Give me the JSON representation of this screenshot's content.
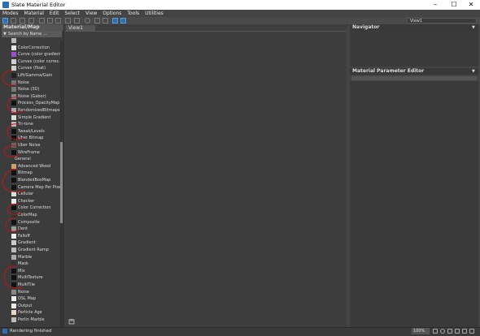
{
  "window": {
    "title": "Slate Material Editor",
    "controls": [
      "–",
      "☐",
      "✕"
    ]
  },
  "menu": [
    "Modes",
    "Material",
    "Edit",
    "Select",
    "View",
    "Options",
    "Tools",
    "Utilities"
  ],
  "toolbar": {
    "view_dropdown": "View1"
  },
  "material_browser": {
    "title": "Material/Map Browser",
    "search_placeholder": "Search by Name ...",
    "sections": [
      {
        "rows": [
          {
            "label": "",
            "swatch": "#bdbdbd"
          },
          {
            "label": "ColorCorrection",
            "swatch": "#e8e8e8"
          },
          {
            "label": "Curve (color gradient)",
            "swatch": "#9a4fc8"
          },
          {
            "label": "Curves (color correc...",
            "swatch": "#cfcfcf"
          },
          {
            "label": "Curves (float)",
            "swatch": "#cfcfcf"
          },
          {
            "label": "Lift/Gamma/Gain",
            "swatch": "#222222"
          },
          {
            "label": "Noise",
            "swatch": "#777777"
          },
          {
            "label": "Noise (3D)",
            "swatch": "#777777"
          },
          {
            "label": "Noise (Gabor)",
            "swatch": "#888888"
          },
          {
            "label": "Process_OpacityMap",
            "swatch": "#111111"
          },
          {
            "label": "RandomizedBitmaps",
            "swatch": "#aaaaaa"
          },
          {
            "label": "Simple Gradient",
            "swatch": "#dddddd"
          },
          {
            "label": "Tri-tone",
            "swatch": "#bbbbbb"
          },
          {
            "label": "Tweak/Levels",
            "swatch": "#111111"
          },
          {
            "label": "Uber Bitmap",
            "swatch": "#111111"
          },
          {
            "label": "Uber Noise",
            "swatch": "#666666"
          },
          {
            "label": "WireFrame",
            "swatch": "#111111"
          }
        ]
      },
      {
        "group": "General",
        "rows": [
          {
            "label": "Advanced Wood",
            "swatch": "#c8a070"
          },
          {
            "label": "Bitmap",
            "swatch": "#111111"
          },
          {
            "label": "BlendedBoxMap",
            "swatch": "#111111"
          },
          {
            "label": "Camera Map Per Pixel",
            "swatch": "#111111"
          },
          {
            "label": "Cellular",
            "swatch": "#dddddd"
          },
          {
            "label": "Checker",
            "swatch": "#eeeeee"
          },
          {
            "label": "Color Correction",
            "swatch": "#111111"
          },
          {
            "label": "ColorMap",
            "swatch": "#333333"
          },
          {
            "label": "Composite",
            "swatch": "#111111"
          },
          {
            "label": "Dent",
            "swatch": "#999999"
          },
          {
            "label": "Falloff",
            "swatch": "#eeeeee"
          },
          {
            "label": "Gradient",
            "swatch": "#cccccc"
          },
          {
            "label": "Gradient Ramp",
            "swatch": "#bbbbbb"
          },
          {
            "label": "Marble",
            "swatch": "#aaaaaa"
          },
          {
            "label": "Mask",
            "swatch": "#333333"
          },
          {
            "label": "Mix",
            "swatch": "#111111"
          },
          {
            "label": "MultiTexture",
            "swatch": "#111111"
          },
          {
            "label": "MultiTile",
            "swatch": "#111111"
          },
          {
            "label": "Noise",
            "swatch": "#888888"
          },
          {
            "label": "OSL Map",
            "swatch": "#eeeeee"
          },
          {
            "label": "Output",
            "swatch": "#eeeeee"
          },
          {
            "label": "Particle Age",
            "swatch": "#e8d8c0"
          },
          {
            "label": "Perlin Marble",
            "swatch": "#bbbbbb"
          }
        ]
      }
    ]
  },
  "view": {
    "tab": "View1"
  },
  "navigator": {
    "title": "Navigator"
  },
  "parameter_editor": {
    "title": "Material Parameter Editor"
  },
  "status": {
    "text": "Rendering finished",
    "zoom": "100%"
  }
}
